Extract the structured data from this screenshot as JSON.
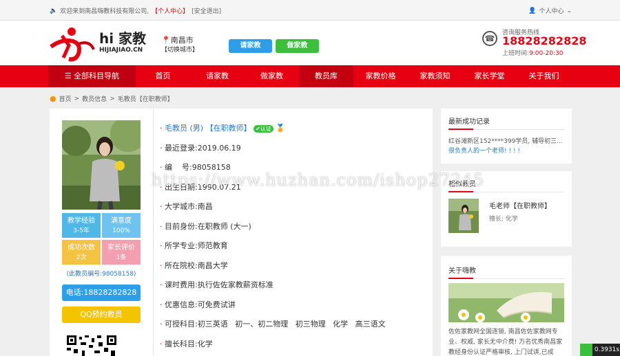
{
  "topbar": {
    "welcome": "欢迎来到南昌嗨教科技有限公司,",
    "personal_center": "【个人中心】",
    "logout": "[安全退出]",
    "user_menu": "个人中心"
  },
  "header": {
    "logo_text": "hi 家教",
    "logo_sub": "HIJIAJIAO.CN",
    "city": "南昌市",
    "switch_city": "【切换城市】",
    "hire_tutor_button": "请家教",
    "be_tutor_button": "做家教",
    "hotline_label": "咨询服务热线",
    "hotline_number": "18828282828",
    "hours_label": "上班时间:",
    "hours": "9:00-20:30"
  },
  "nav": {
    "all_categories": "全部科目导航",
    "items": [
      "首页",
      "请家教",
      "做家教",
      "教员库",
      "家教价格",
      "家教须知",
      "家长学堂",
      "关于我们"
    ],
    "active_index": 3
  },
  "breadcrumb": [
    "首页",
    "教员信息",
    "毛教员【在职教师】"
  ],
  "teacher": {
    "stats": [
      {
        "label": "教学经验",
        "value": "3-5年",
        "color": "#4fb8e6"
      },
      {
        "label": "满意度",
        "value": "100%",
        "color": "#6fc3f0"
      },
      {
        "label": "成功次数",
        "value": "2次",
        "color": "#f5c342"
      },
      {
        "label": "家长评价",
        "value": "1条",
        "color": "#f49fb0"
      }
    ],
    "id_note": "(此教员编号:98058158)",
    "phone_button": "电话:18828282828",
    "qq_button": "QQ预约教员",
    "name": "毛教员 (男)",
    "title_tag": "【在职教师】",
    "verified": "认证",
    "fields": [
      {
        "label": "最近登录:",
        "value": "2019.06.19"
      },
      {
        "label": "编    号:",
        "value": "98058158"
      },
      {
        "label": "出生日期:",
        "value": "1990.07.21"
      },
      {
        "label": "大学城市:",
        "value": "南昌"
      },
      {
        "label": "目前身份:",
        "value": "在职教师 (大一)"
      },
      {
        "label": "所学专业:",
        "value": "师范教育"
      },
      {
        "label": "所在院校:",
        "value": "南昌大学"
      },
      {
        "label": "课时费用:",
        "value": "执行佐佐家教薪资标准"
      },
      {
        "label": "优惠信息:",
        "value": "可免费试讲"
      },
      {
        "label": "可授科目:",
        "value": "初三英语   初一、初二物理   初三物理   化学   高三语文"
      },
      {
        "label": "擅长科目:",
        "value": "化学"
      }
    ]
  },
  "sidebar": {
    "recent_title": "最新成功记录",
    "recent_line1": "红谷滩新区152****399学员, 辅导初三...",
    "recent_line2": "很负责人的一个老师! ! ! !",
    "similar_title": "相似教员",
    "similar_name": "毛老师【在职教师】",
    "similar_sub": "擅长: 化学",
    "about_title": "关于嗨教",
    "about_text": "佐佐家教网全国连锁, 南昌佐佐家教网专业、权威, 家长无中介费! 万名优秀南昌家教经身份认证严格审核, 上门试讲,已成"
  },
  "watermark": "https://www.huzhan.com/ishop27245",
  "timer": "0.3931s",
  "colors": {
    "brand_red": "#e60012",
    "blue": "#2f9ee8",
    "green": "#3cbf3c",
    "yellow": "#f5c400"
  }
}
